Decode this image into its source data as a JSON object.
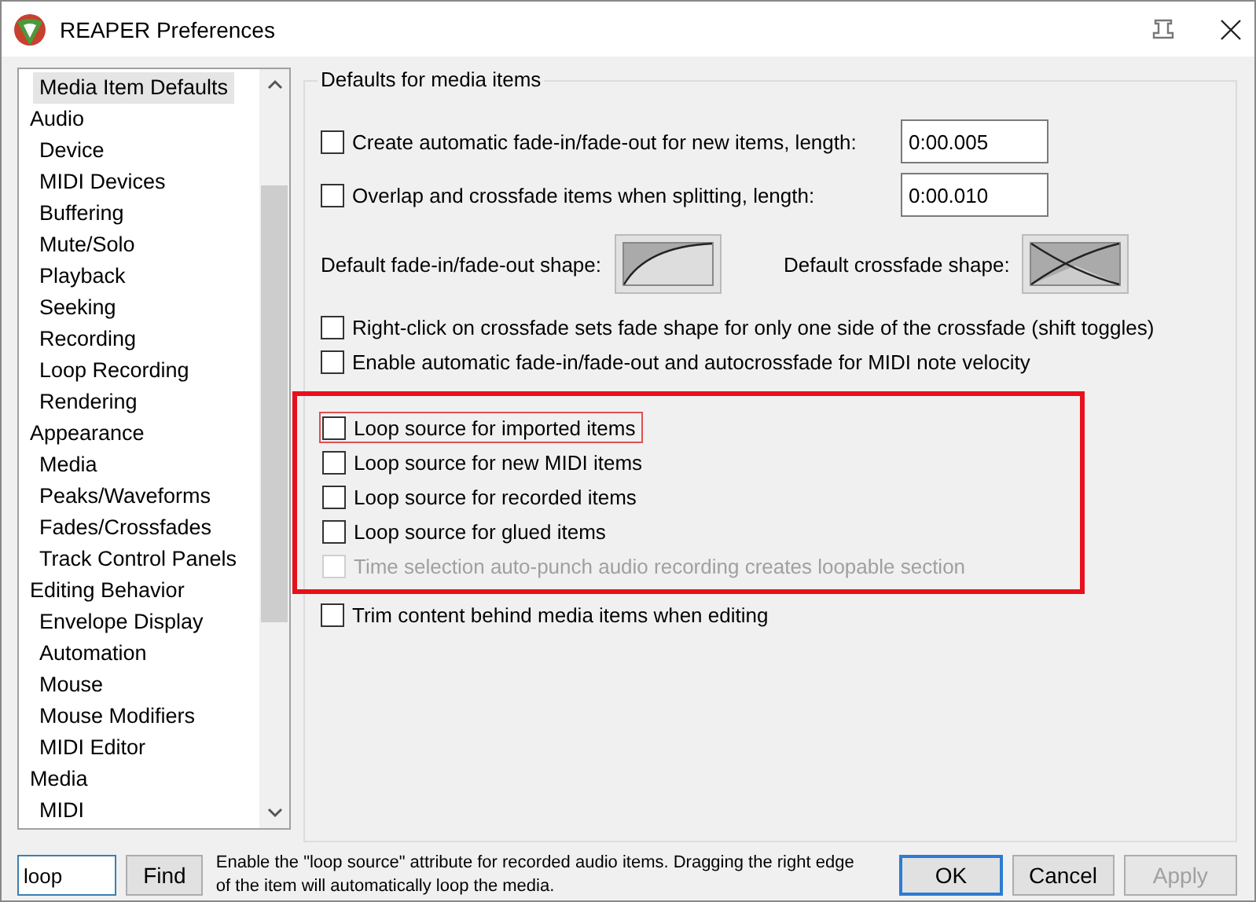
{
  "window": {
    "title": "REAPER Preferences"
  },
  "tree": [
    {
      "children": [
        {
          "label": "Media Item Defaults",
          "selected": true
        }
      ]
    },
    {
      "label": "Audio",
      "selected": false,
      "children": [
        {
          "label": "Device",
          "selected": false
        },
        {
          "label": "MIDI Devices",
          "selected": false
        },
        {
          "label": "Buffering",
          "selected": false
        },
        {
          "label": "Mute/Solo",
          "selected": false
        },
        {
          "label": "Playback",
          "selected": false
        },
        {
          "label": "Seeking",
          "selected": false
        },
        {
          "label": "Recording",
          "selected": false
        },
        {
          "label": "Loop Recording",
          "selected": false
        },
        {
          "label": "Rendering",
          "selected": false
        }
      ]
    },
    {
      "label": "Appearance",
      "selected": false,
      "children": [
        {
          "label": "Media",
          "selected": false
        },
        {
          "label": "Peaks/Waveforms",
          "selected": false
        },
        {
          "label": "Fades/Crossfades",
          "selected": false
        },
        {
          "label": "Track Control Panels",
          "selected": false
        }
      ]
    },
    {
      "label": "Editing Behavior",
      "selected": false,
      "children": [
        {
          "label": "Envelope Display",
          "selected": false
        },
        {
          "label": "Automation",
          "selected": false
        },
        {
          "label": "Mouse",
          "selected": false
        },
        {
          "label": "Mouse Modifiers",
          "selected": false
        },
        {
          "label": "MIDI Editor",
          "selected": false
        }
      ]
    },
    {
      "label": "Media",
      "selected": false,
      "children": [
        {
          "label": "MIDI",
          "selected": false
        }
      ]
    }
  ],
  "group": {
    "title": "Defaults for media items"
  },
  "fields": [
    {
      "label": "Create automatic fade-in/fade-out for new items, length:",
      "checked": false,
      "value": "0:00.005"
    },
    {
      "label": "Overlap and crossfade items when splitting, length:",
      "checked": false,
      "value": "0:00.010"
    }
  ],
  "shapes": [
    {
      "label": "Default fade-in/fade-out shape:",
      "kind": "fade"
    },
    {
      "label": "Default crossfade shape:",
      "kind": "crossfade"
    }
  ],
  "options_before": [
    {
      "label": "Right-click on crossfade sets fade shape for only one side of the crossfade (shift toggles)",
      "checked": false,
      "disabled": false
    },
    {
      "label": "Enable automatic fade-in/fade-out and autocrossfade for MIDI note velocity",
      "checked": false,
      "disabled": false
    }
  ],
  "highlighted_options": [
    {
      "label": "Loop source for imported items",
      "checked": false,
      "disabled": false,
      "outlined": true
    },
    {
      "label": "Loop source for new MIDI items",
      "checked": false,
      "disabled": false,
      "outlined": false
    },
    {
      "label": "Loop source for recorded items",
      "checked": false,
      "disabled": false,
      "outlined": false
    },
    {
      "label": "Loop source for glued items",
      "checked": false,
      "disabled": false,
      "outlined": false
    },
    {
      "label": "Time selection auto-punch audio recording creates loopable section",
      "checked": false,
      "disabled": true,
      "outlined": false
    }
  ],
  "options_after": [
    {
      "label": "Trim content behind media items when editing",
      "checked": false,
      "disabled": false
    }
  ],
  "footer": {
    "search": "loop",
    "find": "Find",
    "hint": "Enable the \"loop source\" attribute for recorded audio items. Dragging the right edge of the item will automatically loop the media.",
    "buttons": [
      {
        "label": "OK",
        "default": true,
        "disabled": false
      },
      {
        "label": "Cancel",
        "default": false,
        "disabled": false
      },
      {
        "label": "Apply",
        "default": false,
        "disabled": true
      }
    ]
  }
}
